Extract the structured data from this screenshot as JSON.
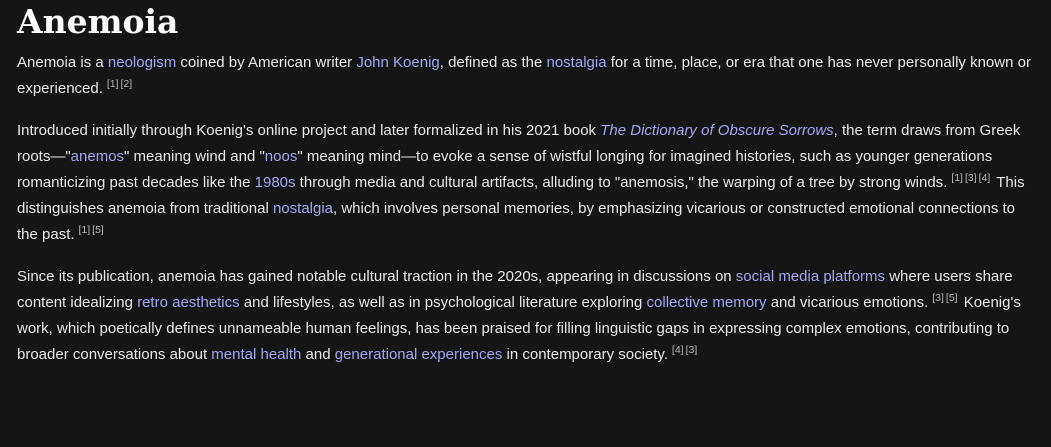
{
  "title": "Anemoia",
  "p1": {
    "t1": "Anemoia is a ",
    "l1": "neologism",
    "t2": " coined by American writer ",
    "l2": "John Koenig",
    "t3": ", defined as the ",
    "l3": "nostalgia",
    "t4": " for a time, place, or era that one has never personally known or experienced.",
    "refs": [
      "[1]",
      "[2]"
    ]
  },
  "p2": {
    "t1": "Introduced initially through Koenig's online project and later formalized in his 2021 book ",
    "l1": "The Dictionary of Obscure Sorrows",
    "t2": ", the term draws from Greek roots—\"",
    "l2": "anemos",
    "t3": "\" meaning wind and \"",
    "l3": "noos",
    "t4": "\" meaning mind—to evoke a sense of wistful longing for imagined histories, such as younger generations romanticizing past decades like the ",
    "l4": "1980s",
    "t5": " through media and cultural artifacts, alluding to \"anemosis,\" the warping of a tree by strong winds.",
    "refs_a": [
      "[1]",
      "[3]",
      "[4]"
    ],
    "t6": " This distinguishes anemoia from traditional ",
    "l5": "nostalgia",
    "t7": ", which involves personal memories, by emphasizing vicarious or constructed emotional connections to the past.",
    "refs_b": [
      "[1]",
      "[5]"
    ]
  },
  "p3": {
    "t1": "Since its publication, anemoia has gained notable cultural traction in the 2020s, appearing in discussions on ",
    "l1": "social media platforms",
    "t2": " where users share content idealizing ",
    "l2": "retro aesthetics",
    "t3": " and lifestyles, as well as in psychological literature exploring ",
    "l3": "collective memory",
    "t4": " and vicarious emotions.",
    "refs_a": [
      "[3]",
      "[5]"
    ],
    "t5": " Koenig's work, which poetically defines unnameable human feelings, has been praised for filling linguistic gaps in expressing complex emotions, contributing to broader conversations about ",
    "l4": "mental health",
    "t6": " and ",
    "l5": "generational experiences",
    "t7": " in contemporary society.",
    "refs_b": [
      "[4]",
      "[3]"
    ]
  },
  "colors": {
    "background": "#151515",
    "text": "#e8e8e8",
    "link": "#a3a6f0",
    "heading": "#ffffff"
  }
}
